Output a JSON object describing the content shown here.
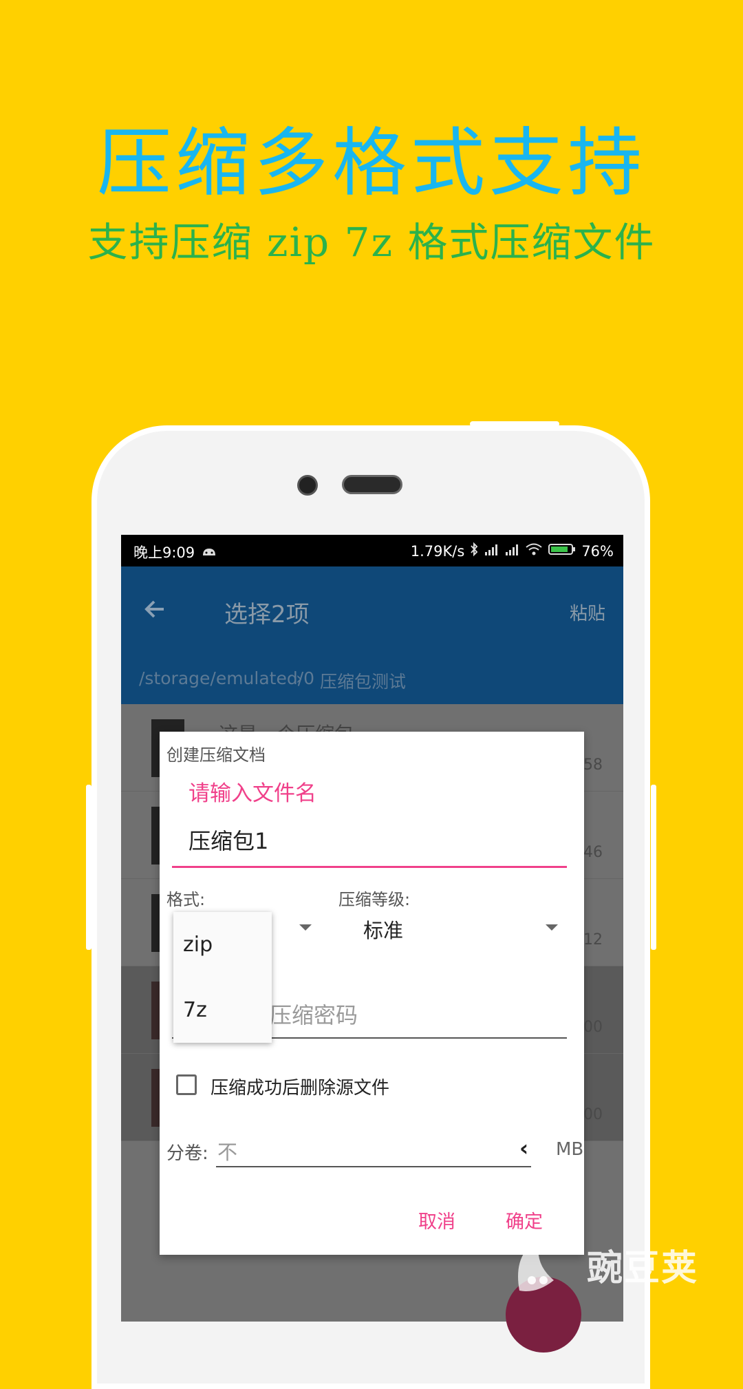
{
  "promo": {
    "title": "压缩多格式支持",
    "subtitle": "支持压缩 zip 7z 格式压缩文件"
  },
  "statusbar": {
    "time": "晚上9:09",
    "speed": "1.79K/s",
    "battery": "76%"
  },
  "appbar": {
    "title": "选择2项",
    "action": "粘贴",
    "breadcrumb_path": "/storage/emulated/0",
    "breadcrumb_separator": "›",
    "breadcrumb_current": "压缩包测试"
  },
  "list": {
    "partial_title": "这是一个压缩包",
    "sizes": [
      "58",
      "46",
      "12",
      "00",
      "00"
    ]
  },
  "dialog": {
    "title": "创建压缩文档",
    "name_label": "请输入文件名",
    "name_value": "压缩包1",
    "format_label": "格式:",
    "level_label": "压缩等级:",
    "level_value": "标准",
    "password_placeholder": "压缩密码",
    "delete_source_label": "压缩成功后删除源文件",
    "delete_source_checked": false,
    "volume_label": "分卷:",
    "volume_value": "不",
    "volume_unit": "MB",
    "cancel": "取消",
    "confirm": "确定"
  },
  "format_menu": {
    "options": [
      "zip",
      "7z"
    ]
  },
  "watermark": "豌豆荚",
  "colors": {
    "background": "#FFD000",
    "title": "#19B6F0",
    "subtitle": "#2BB24C",
    "accent": "#F0408A",
    "appbar": "#0f4878"
  }
}
